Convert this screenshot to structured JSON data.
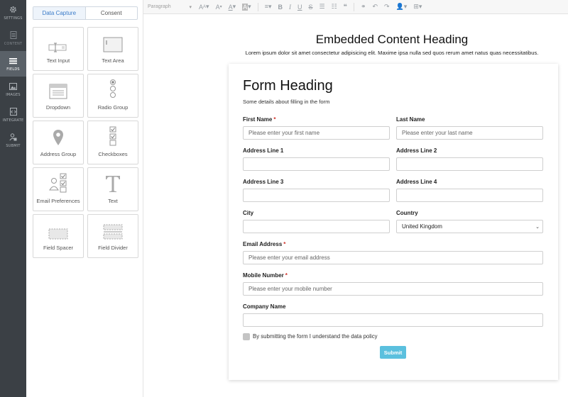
{
  "rail": {
    "items": [
      {
        "label": "SETTINGS"
      },
      {
        "label": "CONTENT"
      },
      {
        "label": "FIELDS"
      },
      {
        "label": "IMAGES"
      },
      {
        "label": "INTEGRATE"
      },
      {
        "label": "SUBMIT"
      }
    ]
  },
  "palette": {
    "tabs": [
      "Data Capture",
      "Consent"
    ],
    "tiles": [
      "Text Input",
      "Text Area",
      "Dropdown",
      "Radio Group",
      "Address Group",
      "Checkboxes",
      "Email Preferences",
      "Text",
      "Field Spacer",
      "Field Divider"
    ]
  },
  "toolbar": {
    "format_select": "Paragraph"
  },
  "embed": {
    "heading": "Embedded Content Heading",
    "subtext": "Lorem ipsum dolor sit amet consectetur adipisicing elit. Maxime ipsa nulla sed quos rerum amet natus quas necessitatibus."
  },
  "form": {
    "title": "Form Heading",
    "subtitle": "Some details about filling in the form",
    "required_mark": "*",
    "fields": {
      "first_name": {
        "label": "First Name",
        "placeholder": "Please enter your first name"
      },
      "last_name": {
        "label": "Last Name",
        "placeholder": "Please enter your last name"
      },
      "address1": {
        "label": "Address Line 1"
      },
      "address2": {
        "label": "Address Line 2"
      },
      "address3": {
        "label": "Address Line 3"
      },
      "address4": {
        "label": "Address Line 4"
      },
      "city": {
        "label": "City"
      },
      "country": {
        "label": "Country",
        "value": "United Kingdom"
      },
      "email": {
        "label": "Email Address",
        "placeholder": "Please enter your email address"
      },
      "mobile": {
        "label": "Mobile Number",
        "placeholder": "Please enter your mobile number"
      },
      "company": {
        "label": "Company Name"
      }
    },
    "consent_label": "By submitting the form I understand the data policy",
    "submit_label": "Submit"
  },
  "colors": {
    "rail_bg": "#3b4045",
    "rail_active": "#5a6168",
    "accent": "#3a7bc8",
    "submit_bg": "#5bc0de",
    "required": "#d0342c"
  }
}
